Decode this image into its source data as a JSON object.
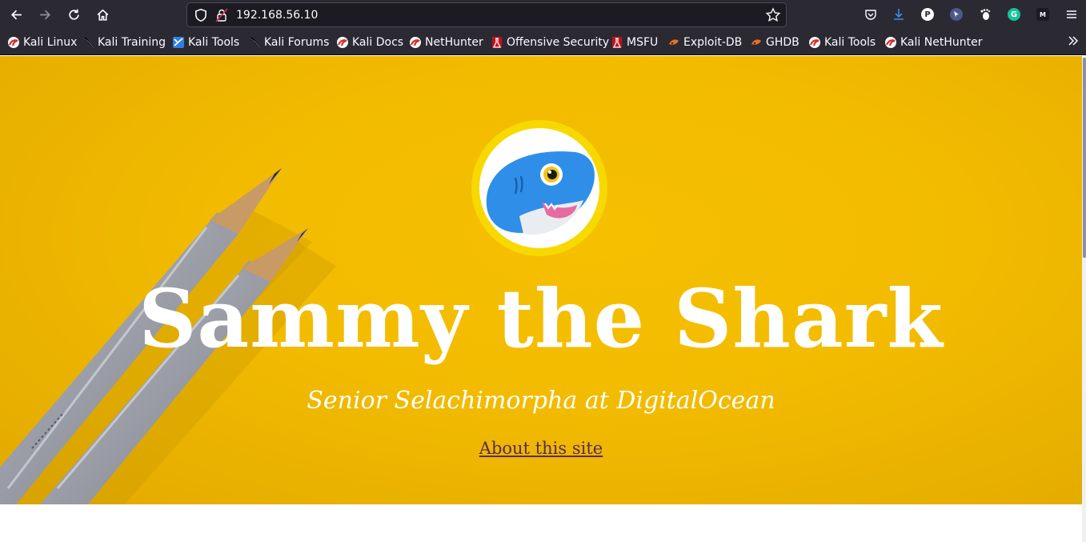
{
  "browser": {
    "url": "192.168.56.10",
    "bookmarks": [
      {
        "label": "Kali Linux",
        "icon": "kali-dragon-red-icon"
      },
      {
        "label": "Kali Training",
        "icon": "kali-dragon-black-icon"
      },
      {
        "label": "Kali Tools",
        "icon": "kali-dragon-blue-icon"
      },
      {
        "label": "Kali Forums",
        "icon": "kali-dragon-black-icon"
      },
      {
        "label": "Kali Docs",
        "icon": "kali-dragon-red-icon"
      },
      {
        "label": "NetHunter",
        "icon": "kali-dragon-red-icon"
      },
      {
        "label": "Offensive Security",
        "icon": "offsec-icon"
      },
      {
        "label": "MSFU",
        "icon": "offsec-icon"
      },
      {
        "label": "Exploit-DB",
        "icon": "exploit-db-icon"
      },
      {
        "label": "GHDB",
        "icon": "exploit-db-icon"
      },
      {
        "label": "Kali Tools",
        "icon": "kali-dragon-red-icon"
      },
      {
        "label": "Kali NetHunter",
        "icon": "kali-dragon-red-icon"
      }
    ],
    "extensions": [
      {
        "name": "pocket-icon"
      },
      {
        "name": "download-icon"
      },
      {
        "name": "p-extension-icon",
        "letter": "P"
      },
      {
        "name": "cursor-extension-icon"
      },
      {
        "name": "gnome-foot-icon"
      },
      {
        "name": "grammarly-icon",
        "letter": "G"
      },
      {
        "name": "m-extension-icon",
        "letter": "M"
      },
      {
        "name": "menu-icon"
      }
    ]
  },
  "page": {
    "title": "Sammy the Shark",
    "subtitle": "Senior Selachimorpha at DigitalOcean",
    "link_label": "About this site"
  },
  "colors": {
    "hero_background": "#f2bb00",
    "avatar_ring": "#f7d900",
    "link": "#5a2a5a",
    "chrome": "#2b2a33"
  }
}
